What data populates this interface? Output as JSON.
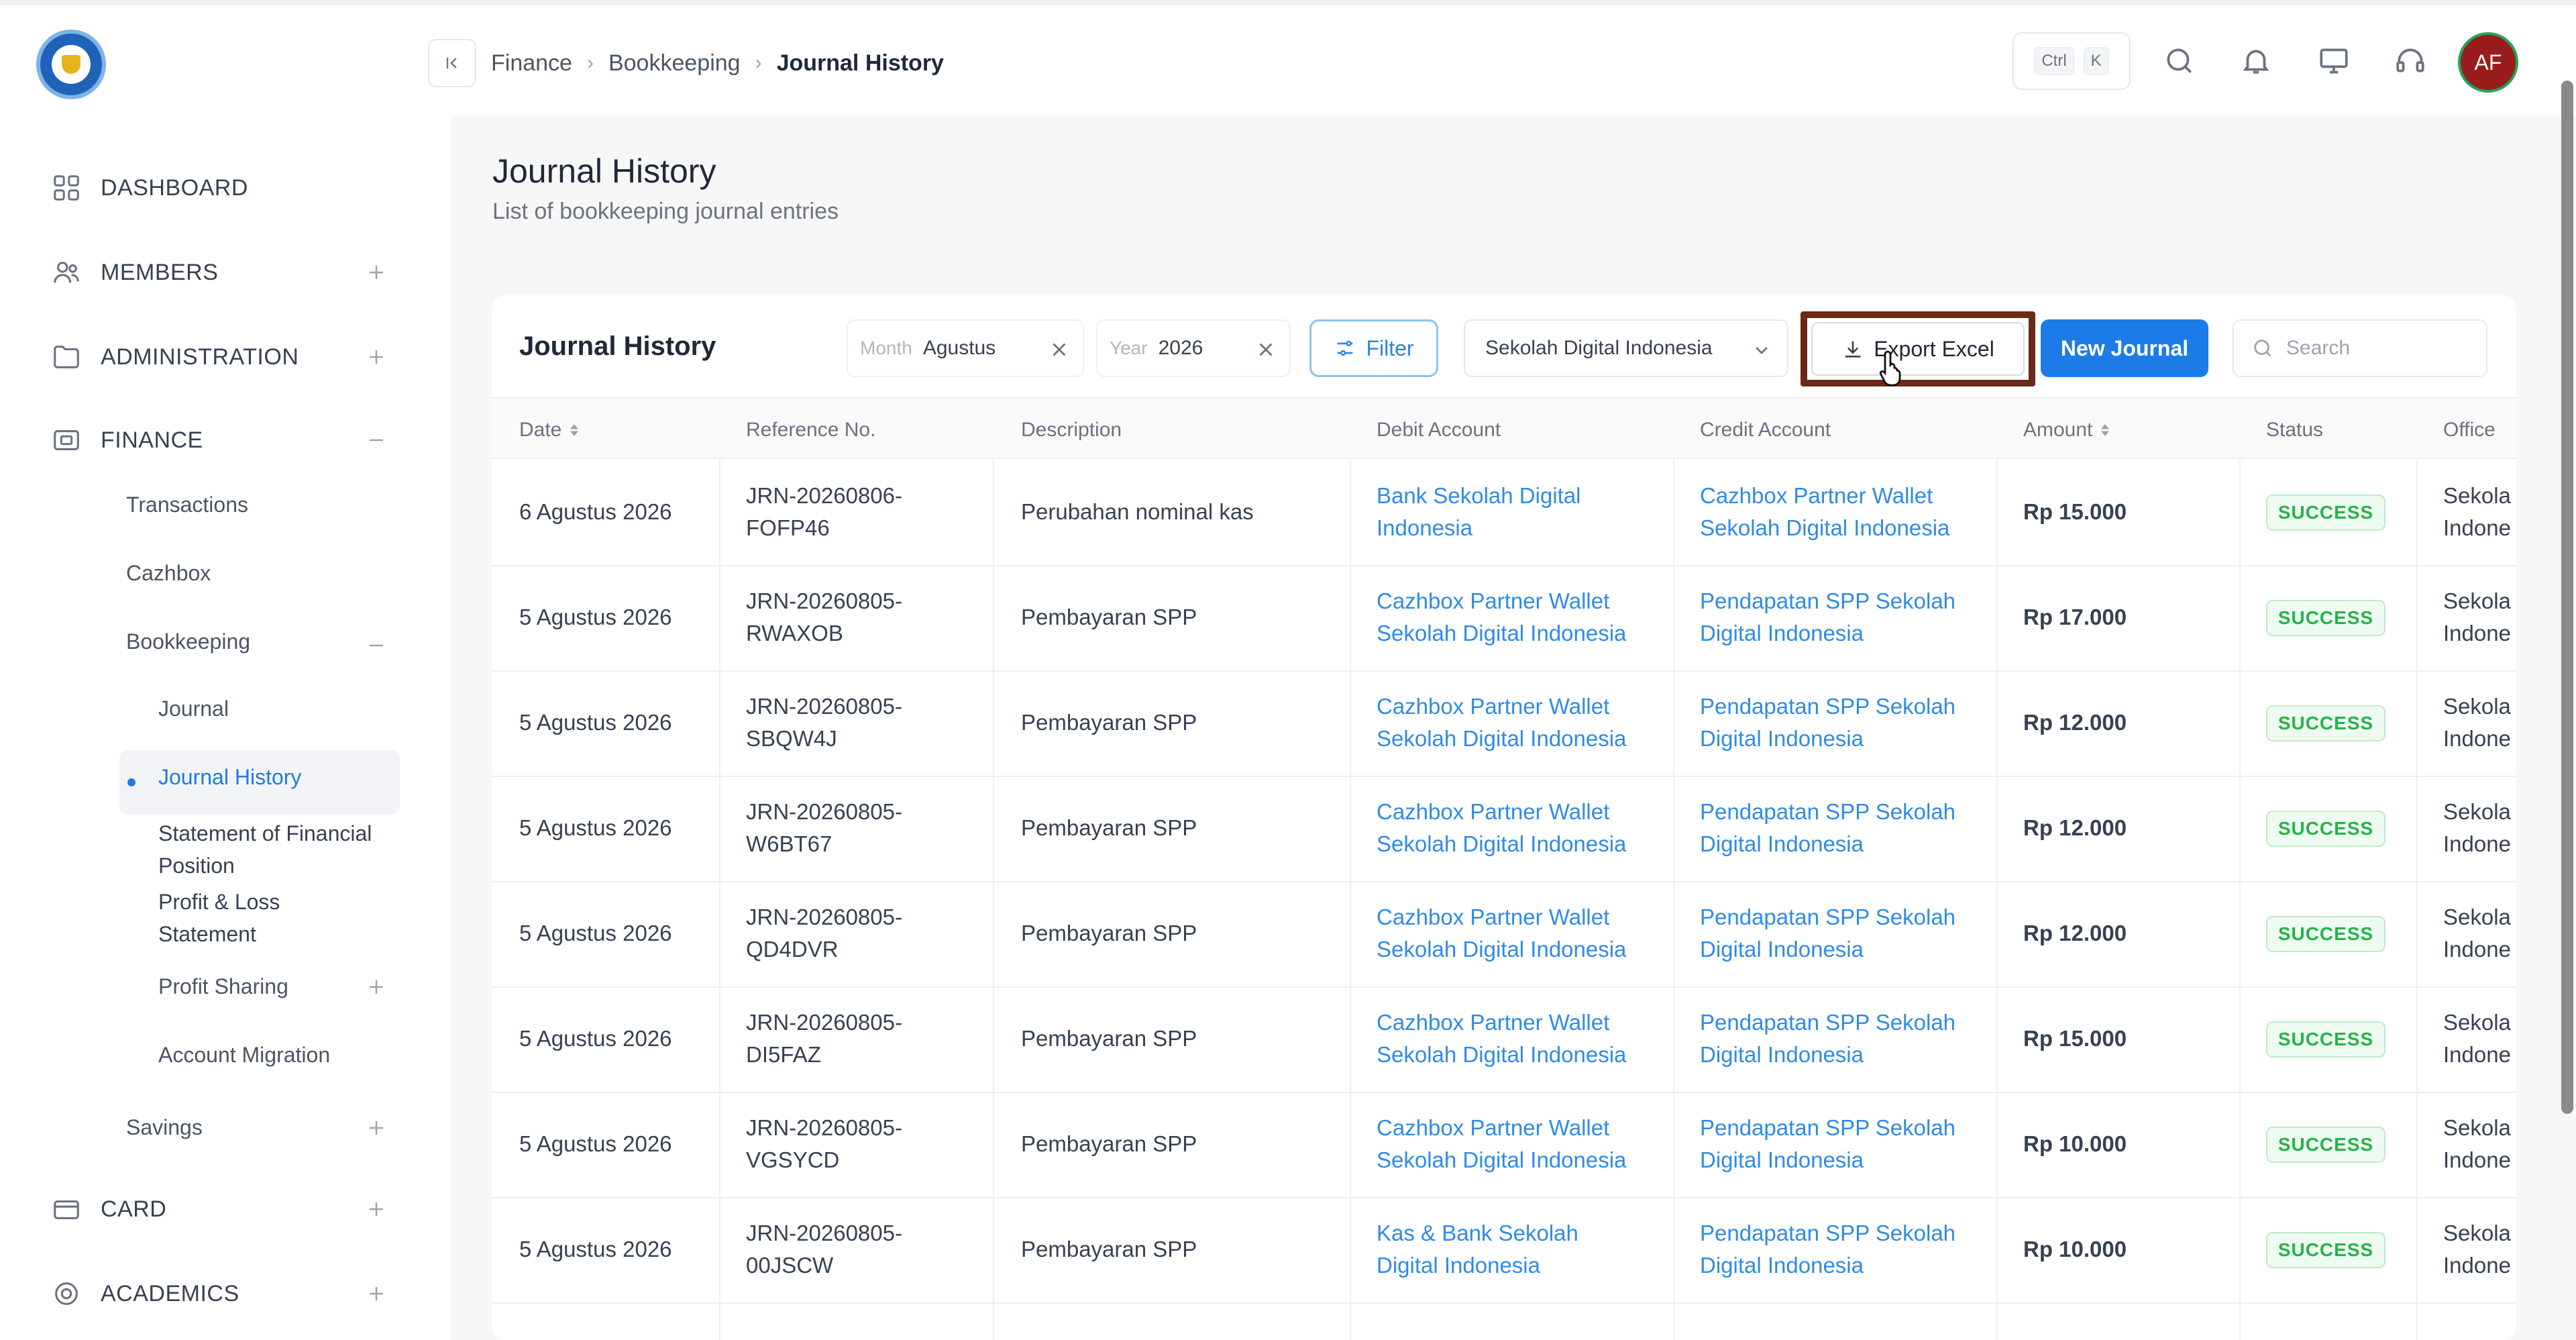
{
  "breadcrumb": {
    "items": [
      "Finance",
      "Bookkeeping"
    ],
    "current": "Journal History"
  },
  "header": {
    "kbd_ctrl": "Ctrl",
    "kbd_k": "K",
    "avatar_initials": "AF"
  },
  "sidebar": {
    "dashboard": "DASHBOARD",
    "members": "MEMBERS",
    "administration": "ADMINISTRATION",
    "finance": "FINANCE",
    "transactions": "Transactions",
    "cazhbox": "Cazhbox",
    "bookkeeping": "Bookkeeping",
    "journal": "Journal",
    "journal_history": "Journal History",
    "statement_financial": "Statement of Financial Position",
    "profit_loss": "Profit & Loss Statement",
    "profit_sharing": "Profit Sharing",
    "account_migration": "Account Migration",
    "savings": "Savings",
    "card": "CARD",
    "academics": "ACADEMICS"
  },
  "page": {
    "title": "Journal History",
    "subtitle": "List of bookkeeping journal entries"
  },
  "card": {
    "title": "Journal History",
    "month_label": "Month",
    "month_value": "Agustus",
    "year_label": "Year",
    "year_value": "2026",
    "filter_label": "Filter",
    "office_select": "Sekolah Digital Indonesia",
    "export_label": "Export Excel",
    "new_label": "New Journal",
    "search_placeholder": "Search"
  },
  "table": {
    "headers": {
      "date": "Date",
      "ref": "Reference No.",
      "desc": "Description",
      "debit": "Debit Account",
      "credit": "Credit Account",
      "amount": "Amount",
      "status": "Status",
      "office": "Office"
    },
    "rows": [
      {
        "date": "6 Agustus 2026",
        "ref1": "JRN-20260806-",
        "ref2": "FOFP46",
        "desc": "Perubahan nominal kas",
        "debit1": "Bank Sekolah Digital",
        "debit2": "Indonesia",
        "credit1": "Cazhbox Partner Wallet",
        "credit2": "Sekolah Digital Indonesia",
        "amount": "Rp 15.000",
        "status": "SUCCESS",
        "office1": "Sekola",
        "office2": "Indone"
      },
      {
        "date": "5 Agustus 2026",
        "ref1": "JRN-20260805-",
        "ref2": "RWAXOB",
        "desc": "Pembayaran SPP",
        "debit1": "Cazhbox Partner Wallet",
        "debit2": "Sekolah Digital Indonesia",
        "credit1": "Pendapatan SPP Sekolah",
        "credit2": "Digital Indonesia",
        "amount": "Rp 17.000",
        "status": "SUCCESS",
        "office1": "Sekola",
        "office2": "Indone"
      },
      {
        "date": "5 Agustus 2026",
        "ref1": "JRN-20260805-",
        "ref2": "SBQW4J",
        "desc": "Pembayaran SPP",
        "debit1": "Cazhbox Partner Wallet",
        "debit2": "Sekolah Digital Indonesia",
        "credit1": "Pendapatan SPP Sekolah",
        "credit2": "Digital Indonesia",
        "amount": "Rp 12.000",
        "status": "SUCCESS",
        "office1": "Sekola",
        "office2": "Indone"
      },
      {
        "date": "5 Agustus 2026",
        "ref1": "JRN-20260805-",
        "ref2": "W6BT67",
        "desc": "Pembayaran SPP",
        "debit1": "Cazhbox Partner Wallet",
        "debit2": "Sekolah Digital Indonesia",
        "credit1": "Pendapatan SPP Sekolah",
        "credit2": "Digital Indonesia",
        "amount": "Rp 12.000",
        "status": "SUCCESS",
        "office1": "Sekola",
        "office2": "Indone"
      },
      {
        "date": "5 Agustus 2026",
        "ref1": "JRN-20260805-",
        "ref2": "QD4DVR",
        "desc": "Pembayaran SPP",
        "debit1": "Cazhbox Partner Wallet",
        "debit2": "Sekolah Digital Indonesia",
        "credit1": "Pendapatan SPP Sekolah",
        "credit2": "Digital Indonesia",
        "amount": "Rp 12.000",
        "status": "SUCCESS",
        "office1": "Sekola",
        "office2": "Indone"
      },
      {
        "date": "5 Agustus 2026",
        "ref1": "JRN-20260805-",
        "ref2": "DI5FAZ",
        "desc": "Pembayaran SPP",
        "debit1": "Cazhbox Partner Wallet",
        "debit2": "Sekolah Digital Indonesia",
        "credit1": "Pendapatan SPP Sekolah",
        "credit2": "Digital Indonesia",
        "amount": "Rp 15.000",
        "status": "SUCCESS",
        "office1": "Sekola",
        "office2": "Indone"
      },
      {
        "date": "5 Agustus 2026",
        "ref1": "JRN-20260805-",
        "ref2": "VGSYCD",
        "desc": "Pembayaran SPP",
        "debit1": "Cazhbox Partner Wallet",
        "debit2": "Sekolah Digital Indonesia",
        "credit1": "Pendapatan SPP Sekolah",
        "credit2": "Digital Indonesia",
        "amount": "Rp 10.000",
        "status": "SUCCESS",
        "office1": "Sekola",
        "office2": "Indone"
      },
      {
        "date": "5 Agustus 2026",
        "ref1": "JRN-20260805-",
        "ref2": "00JSCW",
        "desc": "Pembayaran SPP",
        "debit1": "Kas & Bank Sekolah",
        "debit2": "Digital Indonesia",
        "credit1": "Pendapatan SPP Sekolah",
        "credit2": "Digital Indonesia",
        "amount": "Rp 10.000",
        "status": "SUCCESS",
        "office1": "Sekola",
        "office2": "Indone"
      }
    ]
  },
  "colors": {
    "accent": "#1d7be8",
    "link": "#2f8be6",
    "success": "#27b24a",
    "export_highlight": "#6b2a17"
  }
}
